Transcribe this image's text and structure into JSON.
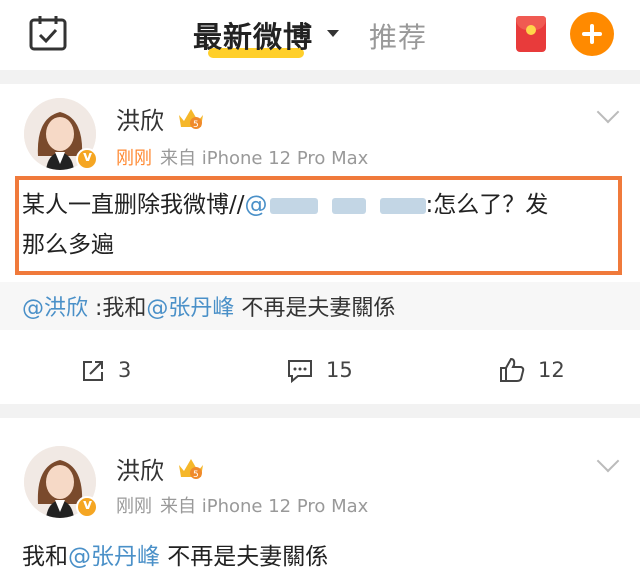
{
  "header": {
    "calendar_icon": "calendar-check-icon",
    "tab_active": "最新微博",
    "tab_other": "推荐",
    "red_packet_icon": "red-envelope-icon",
    "compose_icon": "plus-icon",
    "colors": {
      "accent": "#ff8a00",
      "underline": "#ffcf2a",
      "red": "#e83b3b"
    }
  },
  "post1": {
    "username": "洪欣",
    "time": "刚刚",
    "source": "来自 iPhone 12 Pro Max",
    "text_line1_start": "某人一直删除我微博//",
    "text_line1_at": "@",
    "text_line1_end": ":怎么了？发",
    "text_line2": "那么多遍",
    "quote_mention1": "@洪欣",
    "quote_mid": " :我和",
    "quote_mention2": "@张丹峰",
    "quote_end": " 不再是夫妻關係",
    "repost_count": "3",
    "comment_count": "15",
    "like_count": "12"
  },
  "post2": {
    "username": "洪欣",
    "time": "刚刚",
    "source": "来自 iPhone 12 Pro Max",
    "text_start": "我和",
    "text_mention": "@张丹峰",
    "text_end": " 不再是夫妻關係"
  },
  "colors": {
    "highlight_box": "#f07a3b",
    "mention": "#4a90c8",
    "time": "#ff8a33"
  }
}
